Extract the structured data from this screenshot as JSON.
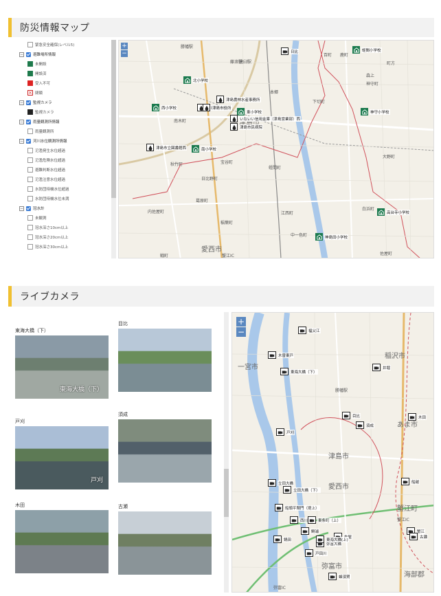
{
  "section1": {
    "title": "防災情報マップ"
  },
  "section2": {
    "title": "ライブカメラ"
  },
  "legend": [
    {
      "kind": "leaf",
      "icon": "warning-icon",
      "label": "緊急安全確保(レベル5)"
    },
    {
      "kind": "group",
      "label": "避難場所情報"
    },
    {
      "kind": "leaf",
      "icon": "school-icon",
      "label": "未開設"
    },
    {
      "kind": "leaf",
      "icon": "school-icon",
      "label": "開設済"
    },
    {
      "kind": "leaf",
      "icon": "full-icon",
      "label": "受入不可"
    },
    {
      "kind": "leaf",
      "icon": "closed-icon",
      "label": "閉鎖"
    },
    {
      "kind": "group",
      "label": "監視カメラ"
    },
    {
      "kind": "leaf",
      "icon": "camera-icon",
      "label": "監視カメラ"
    },
    {
      "kind": "group",
      "label": "雨量観測所情報"
    },
    {
      "kind": "leaf",
      "icon": "rain-gauge-icon",
      "label": "雨量観測所"
    },
    {
      "kind": "group",
      "label": "河川水位観測所情報"
    },
    {
      "kind": "leaf",
      "icon": "flag-icon",
      "label": "氾濫発生水位超過"
    },
    {
      "kind": "leaf",
      "icon": "flag-icon",
      "label": "氾濫危険水位超過"
    },
    {
      "kind": "leaf",
      "icon": "flag-icon",
      "label": "避難判断水位超過"
    },
    {
      "kind": "leaf",
      "icon": "flag-icon",
      "label": "氾濫注意水位超過"
    },
    {
      "kind": "leaf",
      "icon": "flag-icon",
      "label": "水防団待機水位超過"
    },
    {
      "kind": "leaf",
      "icon": "flag-icon",
      "label": "水防団待機水位未満"
    },
    {
      "kind": "group",
      "label": "冠水計"
    },
    {
      "kind": "leaf",
      "icon": "gauge-icon",
      "label": "未観測"
    },
    {
      "kind": "leaf",
      "icon": "gauge-icon",
      "label": "冠水深さ10cm以上"
    },
    {
      "kind": "leaf",
      "icon": "gauge-icon",
      "label": "冠水深さ20cm以上"
    },
    {
      "kind": "leaf",
      "icon": "gauge-icon",
      "label": "冠水深さ30cm以上"
    }
  ],
  "map1": {
    "labels": [
      "勝幡駅",
      "藤浪駅",
      "百町",
      "鹿町",
      "森上",
      "唐臼駅",
      "町方",
      "本郷",
      "神守町",
      "下切町",
      "南木町",
      "津島市",
      "宝谷町",
      "愛西市",
      "蛭間町",
      "日比野町",
      "内佐屋町",
      "稲葉町",
      "大野町",
      "江西町",
      "中一色町",
      "白浜町",
      "佐屋町",
      "戦町",
      "蟹江IC",
      "秋竹町",
      "葛原町"
    ],
    "pins": [
      {
        "type": "school",
        "label": "北小学校"
      },
      {
        "type": "school",
        "label": "西小学校"
      },
      {
        "type": "school",
        "label": "東小学校"
      },
      {
        "type": "school",
        "label": "南小学校"
      },
      {
        "type": "school",
        "label": "神守小学校"
      },
      {
        "type": "school",
        "label": "蛭間小学校"
      },
      {
        "type": "school",
        "label": "神島田小学校"
      },
      {
        "type": "school",
        "label": "高台寺小学校"
      },
      {
        "type": "rain",
        "label": "津島農林水産事務所"
      },
      {
        "type": "rain",
        "label": "津島消防署"
      },
      {
        "type": "rain",
        "label": "いないい信用金庫（津島営業部）西"
      },
      {
        "type": "rain",
        "label": "津島市民病院"
      },
      {
        "type": "rain",
        "label": "津島市立図書館西"
      },
      {
        "type": "rain",
        "label": "津島市役所"
      },
      {
        "type": "cam",
        "label": "日比"
      }
    ]
  },
  "cameras": [
    {
      "name": "東海大橋（下）",
      "overlay": "東海大橋（下）"
    },
    {
      "name": "目比",
      "overlay": ""
    },
    {
      "name": "戸刈",
      "overlay": "戸刈"
    },
    {
      "name": "須成",
      "overlay": ""
    },
    {
      "name": "木田",
      "overlay": ""
    },
    {
      "name": "古瀬",
      "overlay": ""
    }
  ],
  "map2": {
    "labels": [
      "稲沢市",
      "あま市",
      "津島市",
      "愛西市",
      "蟹江町",
      "弥富市",
      "海部郡",
      "一宮市",
      "勝幡駅",
      "蟹江IC",
      "弥富IC"
    ],
    "cams": [
      "福父江",
      "木曽東戸",
      "東海大橋（下）",
      "井堀",
      "目比",
      "木田",
      "戸刈",
      "須成",
      "船越",
      "立田大橋",
      "立田大橋（下）",
      "船頭平閘門（堤上）",
      "西川",
      "東条町（上）",
      "蟹江",
      "弥富大橋",
      "佐屋",
      "古瀬",
      "戸田川",
      "東海大橋(上)",
      "鍋田",
      "鯏浦",
      "蜂須賀"
    ]
  }
}
